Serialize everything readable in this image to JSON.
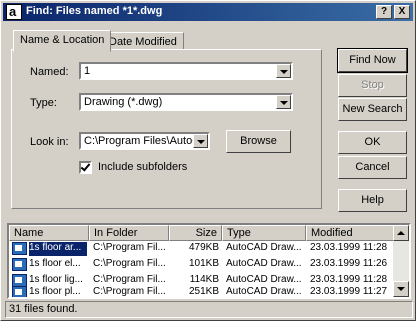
{
  "window": {
    "title": "Find: Files named *1*.dwg",
    "help_glyph": "?",
    "close_glyph": "X"
  },
  "tabs": [
    {
      "label": "Name & Location"
    },
    {
      "label": "Date Modified"
    }
  ],
  "form": {
    "named_label": "Named:",
    "named_value": "1",
    "type_label": "Type:",
    "type_value": "Drawing (*.dwg)",
    "lookin_label": "Look in:",
    "lookin_value": "C:\\Program Files\\AutoCA",
    "browse_label": "Browse",
    "include_subfolders_label": "Include subfolders",
    "include_subfolders_checked": true
  },
  "buttons": {
    "find_now": "Find Now",
    "stop": "Stop",
    "new_search": "New Search",
    "ok": "OK",
    "cancel": "Cancel",
    "help": "Help"
  },
  "results": {
    "columns": [
      "Name",
      "In Folder",
      "Size",
      "Type",
      "Modified"
    ],
    "rows": [
      {
        "name": "1s floor ar...",
        "folder": "C:\\Program Fil...",
        "size": "479KB",
        "type": "AutoCAD Draw...",
        "modified": "23.03.1999 11:28"
      },
      {
        "name": "1s floor el...",
        "folder": "C:\\Program Fil...",
        "size": "101KB",
        "type": "AutoCAD Draw...",
        "modified": "23.03.1999 11:26"
      },
      {
        "name": "1s floor lig...",
        "folder": "C:\\Program Fil...",
        "size": "114KB",
        "type": "AutoCAD Draw...",
        "modified": "23.03.1999 11:28"
      },
      {
        "name": "1s floor pl...",
        "folder": "C:\\Program Fil...",
        "size": "251KB",
        "type": "AutoCAD Draw...",
        "modified": "23.03.1999 11:27"
      }
    ]
  },
  "status": {
    "text": "31 files found."
  }
}
